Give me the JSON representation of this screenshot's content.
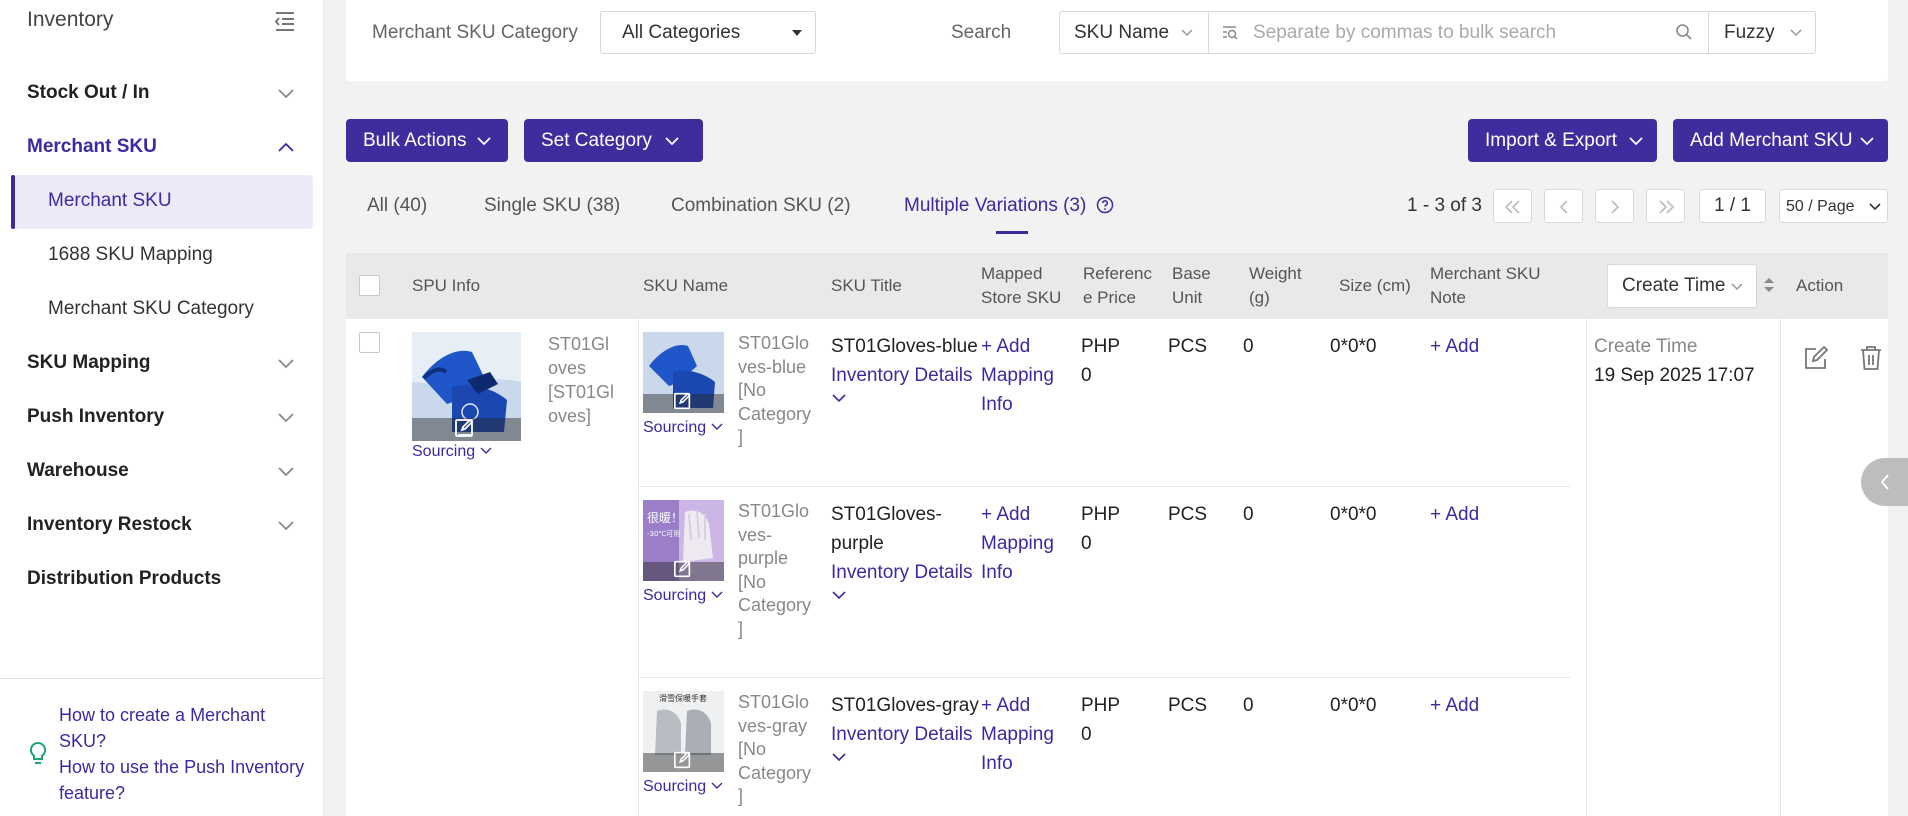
{
  "sidebar": {
    "title": "Inventory",
    "groups": {
      "stock": "Stock Out / In",
      "merchant_sku": "Merchant SKU",
      "sku_mapping": "SKU Mapping",
      "push_inventory": "Push Inventory",
      "warehouse": "Warehouse",
      "restock": "Inventory Restock",
      "distribution": "Distribution Products"
    },
    "sub_items": [
      "Merchant SKU",
      "1688 SKU Mapping",
      "Merchant SKU Category"
    ],
    "help_links": [
      "How to create a Merchant SKU?",
      "How to use the Push Inventory feature?"
    ]
  },
  "filters": {
    "category_label": "Merchant SKU Category",
    "category_value": "All Categories",
    "search_label": "Search",
    "search_field": "SKU Name",
    "search_placeholder": "Separate by commas to bulk search",
    "match_mode": "Fuzzy"
  },
  "toolbar": {
    "bulk_actions": "Bulk Actions",
    "set_category": "Set Category",
    "import_export": "Import & Export",
    "add_merchant_sku": "Add Merchant SKU"
  },
  "tabs": [
    "All (40)",
    "Single SKU (38)",
    "Combination SKU (2)",
    "Multiple Variations (3)"
  ],
  "pagination": {
    "range": "1 - 3 of 3",
    "page": "1 / 1",
    "page_size": "50 / Page"
  },
  "table": {
    "headers": {
      "spu_info": "SPU Info",
      "sku_name": "SKU Name",
      "sku_title": "SKU Title",
      "mapped_line1": "Mapped",
      "mapped_line2": "Store SKU",
      "ref_line1": "Referenc",
      "ref_line2": "e Price",
      "unit_line1": "Base",
      "unit_line2": "Unit",
      "weight_line1": "Weight",
      "weight_line2": "(g)",
      "size": "Size (cm)",
      "note_line1": "Merchant SKU",
      "note_line2": "Note",
      "create_time": "Create Time",
      "action": "Action"
    },
    "spu": {
      "name_lines": [
        "ST01Gl",
        "oves",
        "[ST01Gl",
        "oves]"
      ],
      "sourcing": "Sourcing"
    },
    "create_time_label": "Create Time",
    "create_time_value": "19 Sep 2025 17:07",
    "rows": [
      {
        "name_lines": [
          "ST01Glo",
          "ves-blue",
          "[No",
          "Category",
          "]"
        ],
        "title_lines": [
          "ST01Gloves-blue"
        ],
        "inventory_details": "Inventory Details",
        "mapping_lines": [
          "+ Add",
          "Mapping",
          "Info"
        ],
        "price_currency": "PHP",
        "price_value": "0",
        "unit": "PCS",
        "weight": "0",
        "size": "0*0*0",
        "note_add": "+ Add",
        "sourcing": "Sourcing"
      },
      {
        "name_lines": [
          "ST01Glo",
          "ves-",
          "purple",
          "[No",
          "Category",
          "]"
        ],
        "title_lines": [
          "ST01Gloves-",
          "purple"
        ],
        "inventory_details": "Inventory Details",
        "mapping_lines": [
          "+ Add",
          "Mapping",
          "Info"
        ],
        "price_currency": "PHP",
        "price_value": "0",
        "unit": "PCS",
        "weight": "0",
        "size": "0*0*0",
        "note_add": "+ Add",
        "sourcing": "Sourcing"
      },
      {
        "name_lines": [
          "ST01Glo",
          "ves-gray",
          "[No",
          "Category",
          "]"
        ],
        "title_lines": [
          "ST01Gloves-gray"
        ],
        "inventory_details": "Inventory Details",
        "mapping_lines": [
          "+ Add",
          "Mapping",
          "Info"
        ],
        "price_currency": "PHP",
        "price_value": "0",
        "unit": "PCS",
        "weight": "0",
        "size": "0*0*0",
        "note_add": "+ Add",
        "sourcing": "Sourcing"
      }
    ],
    "thumb_texts": {
      "purple_line1": "很暖！",
      "purple_line2": "-30℃可用",
      "gray_caption": "滑雪保暖手套"
    }
  },
  "colors": {
    "primary": "#3f2d9e",
    "link": "#3a2b9e",
    "help_icon": "#1aa37a"
  }
}
